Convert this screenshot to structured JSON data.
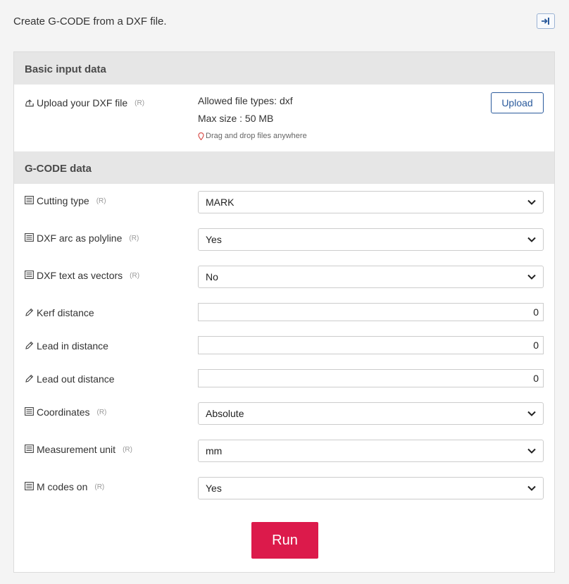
{
  "page": {
    "heading": "Create G-CODE from a DXF file."
  },
  "header": {
    "exit_icon": "sign-in-icon"
  },
  "basic": {
    "title": "Basic input data",
    "upload_label": "Upload your DXF file",
    "required": "(R)",
    "allowed_types": "Allowed file types: dxf",
    "max_size": "Max size : 50 MB",
    "drag_note": "Drag and drop files anywhere",
    "upload_button": "Upload"
  },
  "gcode": {
    "title": "G-CODE data",
    "fields": [
      {
        "label": "Cutting type",
        "required": "(R)",
        "kind": "select",
        "value": "MARK",
        "icon": "list-icon"
      },
      {
        "label": "DXF arc as polyline",
        "required": "(R)",
        "kind": "select",
        "value": "Yes",
        "icon": "list-icon"
      },
      {
        "label": "DXF text as vectors",
        "required": "(R)",
        "kind": "select",
        "value": "No",
        "icon": "list-icon"
      },
      {
        "label": "Kerf distance",
        "required": "",
        "kind": "input",
        "value": "0",
        "icon": "pencil-icon"
      },
      {
        "label": "Lead in distance",
        "required": "",
        "kind": "input",
        "value": "0",
        "icon": "pencil-icon"
      },
      {
        "label": "Lead out distance",
        "required": "",
        "kind": "input",
        "value": "0",
        "icon": "pencil-icon"
      },
      {
        "label": "Coordinates",
        "required": "(R)",
        "kind": "select",
        "value": "Absolute",
        "icon": "list-icon"
      },
      {
        "label": "Measurement unit",
        "required": "(R)",
        "kind": "select",
        "value": "mm",
        "icon": "list-icon"
      },
      {
        "label": "M codes on",
        "required": "(R)",
        "kind": "select",
        "value": "Yes",
        "icon": "list-icon"
      }
    ]
  },
  "actions": {
    "run": "Run"
  },
  "colors": {
    "run": "#dc1a4b",
    "upload_border": "#2a5a9c",
    "section_bg": "#e6e6e6"
  }
}
